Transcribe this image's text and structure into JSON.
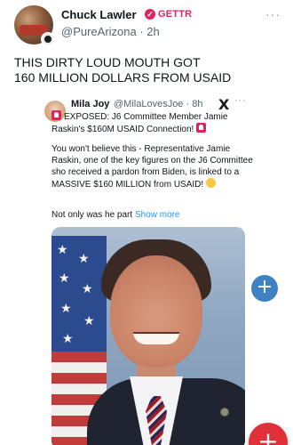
{
  "post": {
    "author_name": "Chuck Lawler",
    "network_tag": "GETTR",
    "author_handle": "@PureArizona · 2h",
    "text": "THIS DIRTY LOUD MOUTH GOT\n 160 MILLION DOLLARS FROM USAID",
    "more_icon": "···"
  },
  "quote": {
    "author_name": "Mila Joy",
    "author_handle": "@MilaLovesJoe · 8h",
    "x_logo": "X",
    "more_icon": "···",
    "headline": "EXPOSED: J6 Committee Member Jamie Raskin's $160M USAID Connection!",
    "body": "You won't believe this - Representative Jamie Raskin, one of the key figures on the J6 Committee sho received a pardon from Biden, is linked to a MASSIVE $160 MILLION from USAID!",
    "more_line": "Not only was he part",
    "show_more": "Show more",
    "image_add_label": "+"
  },
  "fab": {
    "label": "+"
  },
  "colors": {
    "accent_red": "#e0245e",
    "link_blue": "#1d9bf0",
    "handle_gray": "#536471"
  },
  "icons": [
    "verified-badge-icon",
    "more-icon",
    "x-logo-icon",
    "siren-icon",
    "shocked-face-icon",
    "plus-icon",
    "compose-icon"
  ]
}
